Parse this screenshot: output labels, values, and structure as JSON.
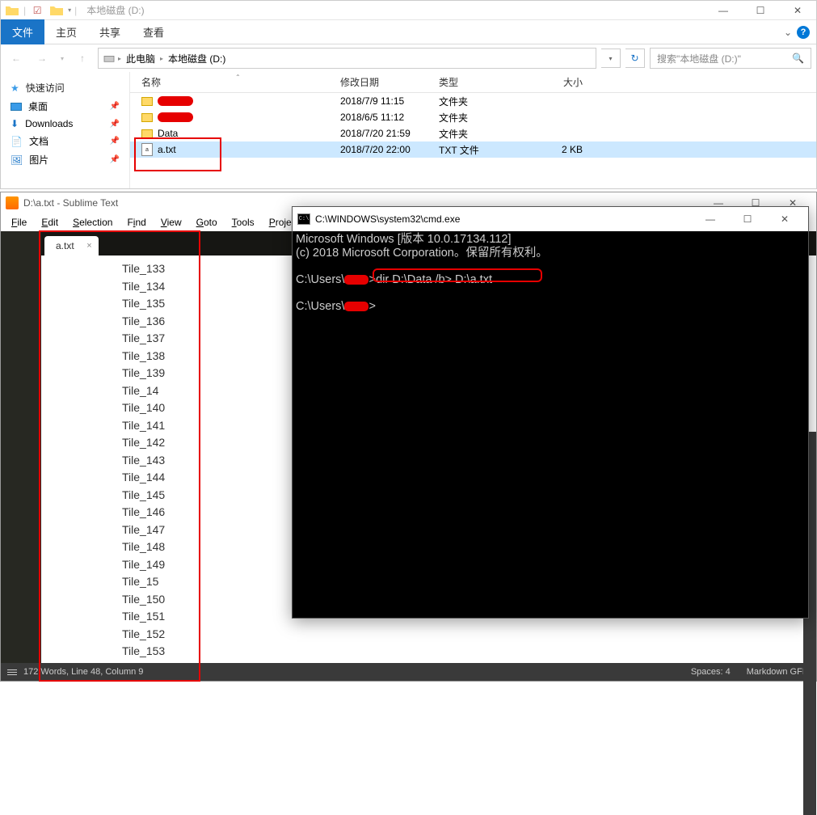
{
  "explorer": {
    "title": "本地磁盘 (D:)",
    "ribbon": {
      "file": "文件",
      "tabs": [
        "主页",
        "共享",
        "查看"
      ]
    },
    "breadcrumbs": [
      "此电脑",
      "本地磁盘 (D:)"
    ],
    "search_placeholder": "搜索\"本地磁盘 (D:)\"",
    "sidebar": {
      "quick": "快速访问",
      "items": [
        "桌面",
        "Downloads",
        "文档",
        "图片"
      ]
    },
    "columns": {
      "name": "名称",
      "date": "修改日期",
      "type": "类型",
      "size": "大小"
    },
    "files": [
      {
        "name": "",
        "redacted": true,
        "date": "2018/7/9 11:15",
        "type": "文件夹",
        "size": "",
        "icon": "folder"
      },
      {
        "name": "",
        "redacted": true,
        "date": "2018/6/5 11:12",
        "type": "文件夹",
        "size": "",
        "icon": "folder"
      },
      {
        "name": "Data",
        "date": "2018/7/20 21:59",
        "type": "文件夹",
        "size": "",
        "icon": "folder"
      },
      {
        "name": "a.txt",
        "date": "2018/7/20 22:00",
        "type": "TXT 文件",
        "size": "2 KB",
        "icon": "txt",
        "selected": true
      }
    ]
  },
  "sublime": {
    "title": "D:\\a.txt - Sublime Text",
    "menus": [
      "File",
      "Edit",
      "Selection",
      "Find",
      "View",
      "Goto",
      "Tools",
      "Project"
    ],
    "tab": "a.txt",
    "lines": [
      "Tile_133",
      "Tile_134",
      "Tile_135",
      "Tile_136",
      "Tile_137",
      "Tile_138",
      "Tile_139",
      "Tile_14",
      "Tile_140",
      "Tile_141",
      "Tile_142",
      "Tile_143",
      "Tile_144",
      "Tile_145",
      "Tile_146",
      "Tile_147",
      "Tile_148",
      "Tile_149",
      "Tile_15",
      "Tile_150",
      "Tile_151",
      "Tile_152",
      "Tile_153"
    ],
    "status": {
      "words": "172 Words",
      "pos": "Line 48, Column 9",
      "spaces": "Spaces: 4",
      "syntax": "Markdown GFM"
    }
  },
  "cmd": {
    "title": "C:\\WINDOWS\\system32\\cmd.exe",
    "line1": "Microsoft Windows [版本 10.0.17134.112]",
    "line2": "(c) 2018 Microsoft Corporation。保留所有权利。",
    "prompt_prefix": "C:\\Users\\",
    "command": "dir D:\\Data /b> D:\\a.txt"
  }
}
